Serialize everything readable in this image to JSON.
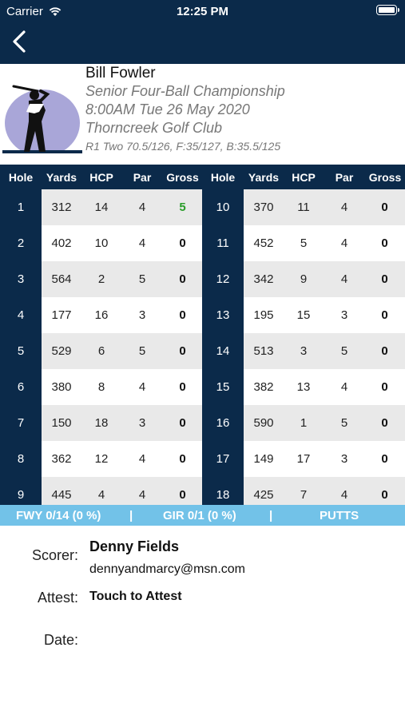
{
  "status_bar": {
    "carrier": "Carrier",
    "time": "12:25 PM"
  },
  "nav": {
    "back_icon": "chevron-left-icon"
  },
  "header": {
    "player": "Bill Fowler",
    "tournament": "Senior Four-Ball Championship",
    "datetime": "8:00AM Tue 26 May 2020",
    "club": "Thorncreek Golf Club",
    "rating": "R1 Two 70.5/126, F:35/127, B:35.5/125",
    "logo_icon": "golfer-logo-icon"
  },
  "columns": [
    "Hole",
    "Yards",
    "HCP",
    "Par",
    "Gross"
  ],
  "front_nine": [
    {
      "hole": "1",
      "yards": "312",
      "hcp": "14",
      "par": "4",
      "gross": "5"
    },
    {
      "hole": "2",
      "yards": "402",
      "hcp": "10",
      "par": "4",
      "gross": "0"
    },
    {
      "hole": "3",
      "yards": "564",
      "hcp": "2",
      "par": "5",
      "gross": "0"
    },
    {
      "hole": "4",
      "yards": "177",
      "hcp": "16",
      "par": "3",
      "gross": "0"
    },
    {
      "hole": "5",
      "yards": "529",
      "hcp": "6",
      "par": "5",
      "gross": "0"
    },
    {
      "hole": "6",
      "yards": "380",
      "hcp": "8",
      "par": "4",
      "gross": "0"
    },
    {
      "hole": "7",
      "yards": "150",
      "hcp": "18",
      "par": "3",
      "gross": "0"
    },
    {
      "hole": "8",
      "yards": "362",
      "hcp": "12",
      "par": "4",
      "gross": "0"
    },
    {
      "hole": "9",
      "yards": "445",
      "hcp": "4",
      "par": "4",
      "gross": "0"
    }
  ],
  "back_nine": [
    {
      "hole": "10",
      "yards": "370",
      "hcp": "11",
      "par": "4",
      "gross": "0"
    },
    {
      "hole": "11",
      "yards": "452",
      "hcp": "5",
      "par": "4",
      "gross": "0"
    },
    {
      "hole": "12",
      "yards": "342",
      "hcp": "9",
      "par": "4",
      "gross": "0"
    },
    {
      "hole": "13",
      "yards": "195",
      "hcp": "15",
      "par": "3",
      "gross": "0"
    },
    {
      "hole": "14",
      "yards": "513",
      "hcp": "3",
      "par": "5",
      "gross": "0"
    },
    {
      "hole": "15",
      "yards": "382",
      "hcp": "13",
      "par": "4",
      "gross": "0"
    },
    {
      "hole": "16",
      "yards": "590",
      "hcp": "1",
      "par": "5",
      "gross": "0"
    },
    {
      "hole": "17",
      "yards": "149",
      "hcp": "17",
      "par": "3",
      "gross": "0"
    },
    {
      "hole": "18",
      "yards": "425",
      "hcp": "7",
      "par": "4",
      "gross": "0"
    }
  ],
  "stats": {
    "fwy": "FWY 0/14 (0 %)",
    "sep1": "|",
    "gir": "GIR 0/1 (0 %)",
    "sep2": "|",
    "putts": "PUTTS"
  },
  "footer": {
    "scorer_label": "Scorer:",
    "scorer_name": "Denny Fields",
    "scorer_email": "dennyandmarcy@msn.com",
    "attest_label": "Attest:",
    "attest_action": "Touch to Attest",
    "date_label": "Date:"
  },
  "colors": {
    "navy": "#0b2a4a",
    "stats_blue": "#72c2e8",
    "scored_green": "#2a9d2a",
    "row_grey": "#e9e9e9"
  }
}
